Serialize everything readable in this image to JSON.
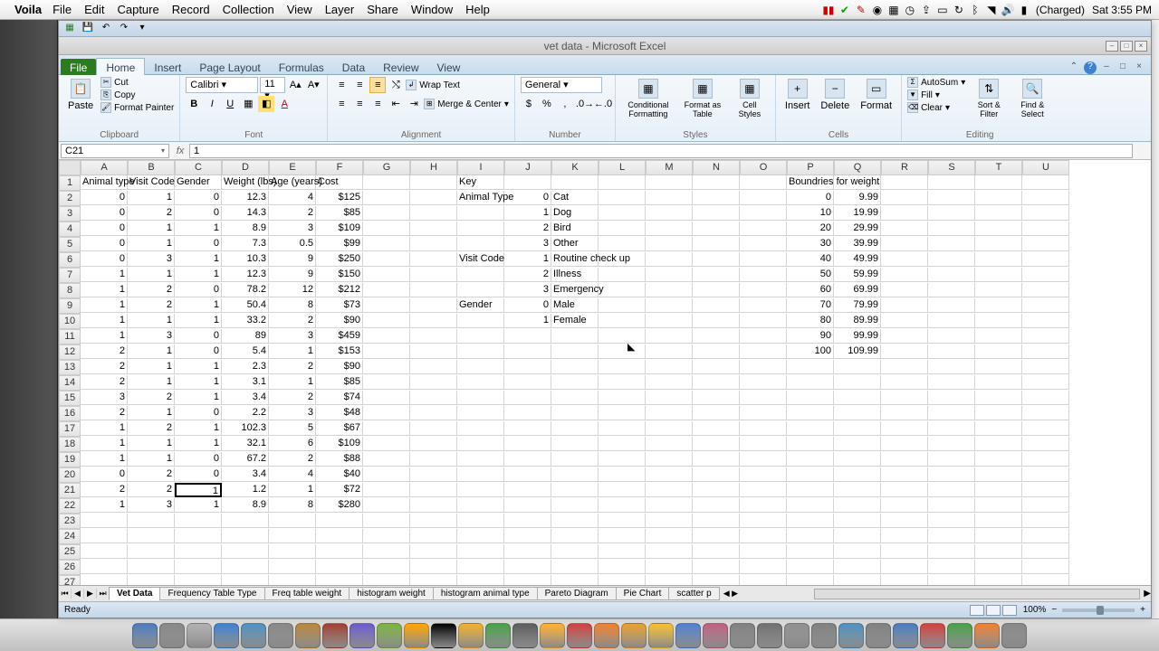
{
  "mac": {
    "app": "Voila",
    "menus": [
      "File",
      "Edit",
      "Capture",
      "Record",
      "Collection",
      "View",
      "Layer",
      "Share",
      "Window",
      "Help"
    ],
    "battery": "(Charged)",
    "clock": "Sat 3:55 PM"
  },
  "window": {
    "title": "vet data - Microsoft Excel"
  },
  "ribbon": {
    "tabs": [
      "File",
      "Home",
      "Insert",
      "Page Layout",
      "Formulas",
      "Data",
      "Review",
      "View"
    ],
    "active": "Home",
    "clipboard": {
      "paste": "Paste",
      "cut": "Cut",
      "copy": "Copy",
      "format_painter": "Format Painter",
      "label": "Clipboard"
    },
    "font": {
      "name": "Calibri",
      "size": "11",
      "label": "Font"
    },
    "alignment": {
      "wrap": "Wrap Text",
      "merge": "Merge & Center",
      "label": "Alignment"
    },
    "number": {
      "format": "General",
      "label": "Number"
    },
    "styles": {
      "cond": "Conditional Formatting",
      "fat": "Format as Table",
      "cell": "Cell Styles",
      "label": "Styles"
    },
    "cells": {
      "insert": "Insert",
      "delete": "Delete",
      "format": "Format",
      "label": "Cells"
    },
    "editing": {
      "autosum": "AutoSum",
      "fill": "Fill",
      "clear": "Clear",
      "sort": "Sort & Filter",
      "find": "Find & Select",
      "label": "Editing"
    }
  },
  "formula": {
    "name_box": "C21",
    "value": "1"
  },
  "columns": [
    "A",
    "B",
    "C",
    "D",
    "E",
    "F",
    "G",
    "H",
    "I",
    "J",
    "K",
    "L",
    "M",
    "N",
    "O",
    "P",
    "Q",
    "R",
    "S",
    "T",
    "U"
  ],
  "rows": 30,
  "data_headers": [
    "Animal type",
    "Visit Code",
    "Gender",
    "Weight (lbs)",
    "Age (years)",
    "Cost"
  ],
  "data_rows": [
    [
      0,
      1,
      0,
      "12.3",
      4,
      "$125"
    ],
    [
      0,
      2,
      0,
      "14.3",
      2,
      "$85"
    ],
    [
      0,
      1,
      1,
      "8.9",
      3,
      "$109"
    ],
    [
      0,
      1,
      0,
      "7.3",
      "0.5",
      "$99"
    ],
    [
      0,
      3,
      1,
      "10.3",
      9,
      "$250"
    ],
    [
      1,
      1,
      1,
      "12.3",
      9,
      "$150"
    ],
    [
      1,
      2,
      0,
      "78.2",
      12,
      "$212"
    ],
    [
      1,
      2,
      1,
      "50.4",
      8,
      "$73"
    ],
    [
      1,
      1,
      1,
      "33.2",
      2,
      "$90"
    ],
    [
      1,
      3,
      0,
      "89",
      3,
      "$459"
    ],
    [
      2,
      1,
      0,
      "5.4",
      1,
      "$153"
    ],
    [
      2,
      1,
      1,
      "2.3",
      2,
      "$90"
    ],
    [
      2,
      1,
      1,
      "3.1",
      1,
      "$85"
    ],
    [
      3,
      2,
      1,
      "3.4",
      2,
      "$74"
    ],
    [
      2,
      1,
      0,
      "2.2",
      3,
      "$48"
    ],
    [
      1,
      2,
      1,
      "102.3",
      5,
      "$67"
    ],
    [
      1,
      1,
      1,
      "32.1",
      6,
      "$109"
    ],
    [
      1,
      1,
      0,
      "67.2",
      2,
      "$88"
    ],
    [
      0,
      2,
      0,
      "3.4",
      4,
      "$40"
    ],
    [
      2,
      2,
      1,
      "1.2",
      1,
      "$72"
    ],
    [
      1,
      3,
      1,
      "8.9",
      8,
      "$280"
    ]
  ],
  "key": {
    "title": "Key",
    "sections": [
      {
        "label": "Animal Type",
        "row": 2,
        "items": [
          [
            0,
            "Cat"
          ],
          [
            1,
            "Dog"
          ],
          [
            2,
            "Bird"
          ],
          [
            3,
            "Other"
          ]
        ]
      },
      {
        "label": "Visit Code",
        "row": 6,
        "items": [
          [
            1,
            "Routine check up"
          ],
          [
            2,
            "Illness"
          ],
          [
            3,
            "Emergency"
          ]
        ]
      },
      {
        "label": "Gender",
        "row": 9,
        "items": [
          [
            0,
            "Male"
          ],
          [
            1,
            "Female"
          ]
        ]
      }
    ]
  },
  "boundaries": {
    "title": "Boundries for weight",
    "rows": [
      [
        0,
        "9.99"
      ],
      [
        10,
        "19.99"
      ],
      [
        20,
        "29.99"
      ],
      [
        30,
        "39.99"
      ],
      [
        40,
        "49.99"
      ],
      [
        50,
        "59.99"
      ],
      [
        60,
        "69.99"
      ],
      [
        70,
        "79.99"
      ],
      [
        80,
        "89.99"
      ],
      [
        90,
        "99.99"
      ],
      [
        100,
        "109.99"
      ]
    ]
  },
  "chart_data": {
    "type": "table",
    "title": "Vet Data",
    "columns": [
      "Animal type",
      "Visit Code",
      "Gender",
      "Weight (lbs)",
      "Age (years)",
      "Cost"
    ],
    "rows": [
      [
        0,
        1,
        0,
        12.3,
        4,
        125
      ],
      [
        0,
        2,
        0,
        14.3,
        2,
        85
      ],
      [
        0,
        1,
        1,
        8.9,
        3,
        109
      ],
      [
        0,
        1,
        0,
        7.3,
        0.5,
        99
      ],
      [
        0,
        3,
        1,
        10.3,
        9,
        250
      ],
      [
        1,
        1,
        1,
        12.3,
        9,
        150
      ],
      [
        1,
        2,
        0,
        78.2,
        12,
        212
      ],
      [
        1,
        2,
        1,
        50.4,
        8,
        73
      ],
      [
        1,
        1,
        1,
        33.2,
        2,
        90
      ],
      [
        1,
        3,
        0,
        89,
        3,
        459
      ],
      [
        2,
        1,
        0,
        5.4,
        1,
        153
      ],
      [
        2,
        1,
        1,
        2.3,
        2,
        90
      ],
      [
        2,
        1,
        1,
        3.1,
        1,
        85
      ],
      [
        3,
        2,
        1,
        3.4,
        2,
        74
      ],
      [
        2,
        1,
        0,
        2.2,
        3,
        48
      ],
      [
        1,
        2,
        1,
        102.3,
        5,
        67
      ],
      [
        1,
        1,
        1,
        32.1,
        6,
        109
      ],
      [
        1,
        1,
        0,
        67.2,
        2,
        88
      ],
      [
        0,
        2,
        0,
        3.4,
        4,
        40
      ],
      [
        2,
        2,
        1,
        1.2,
        1,
        72
      ],
      [
        1,
        3,
        1,
        8.9,
        8,
        280
      ]
    ],
    "key": {
      "animal_type": {
        "0": "Cat",
        "1": "Dog",
        "2": "Bird",
        "3": "Other"
      },
      "visit_code": {
        "1": "Routine check up",
        "2": "Illness",
        "3": "Emergency"
      },
      "gender": {
        "0": "Male",
        "1": "Female"
      }
    },
    "boundaries_weight": [
      [
        0,
        9.99
      ],
      [
        10,
        19.99
      ],
      [
        20,
        29.99
      ],
      [
        30,
        39.99
      ],
      [
        40,
        49.99
      ],
      [
        50,
        59.99
      ],
      [
        60,
        69.99
      ],
      [
        70,
        79.99
      ],
      [
        80,
        89.99
      ],
      [
        90,
        99.99
      ],
      [
        100,
        109.99
      ]
    ]
  },
  "sheets": [
    "Vet Data",
    "Frequency Table Type",
    "Freq table weight",
    "histogram weight",
    "histogram animal type",
    "Pareto Diagram",
    "Pie Chart",
    "scatter p"
  ],
  "active_sheet": "Vet Data",
  "status": {
    "ready": "Ready",
    "zoom": "100%"
  }
}
